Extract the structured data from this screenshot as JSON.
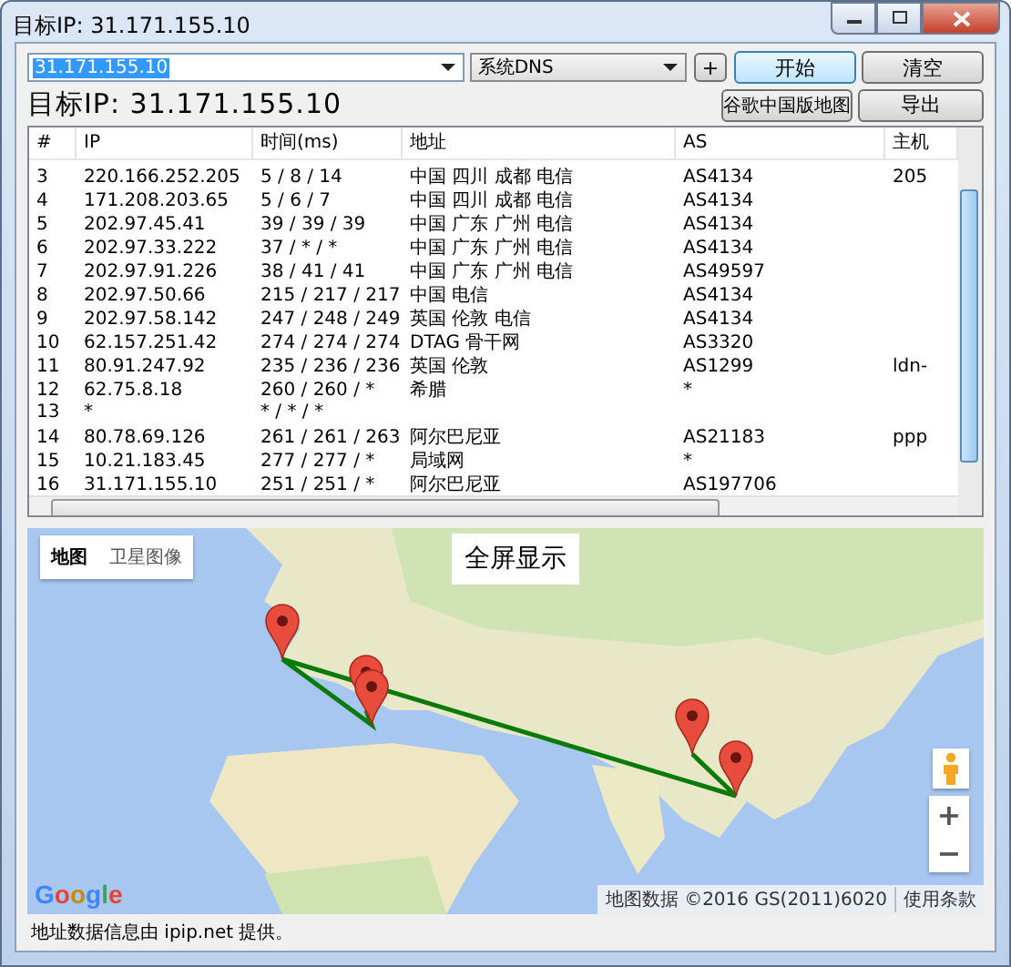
{
  "window": {
    "title": "目标IP: 31.171.155.10"
  },
  "toolbar": {
    "target": {
      "value": "31.171.155.10"
    },
    "dns": {
      "value": "系统DNS"
    },
    "add_button": "+",
    "start_button": "开始",
    "clear_button": "清空",
    "map_button": "谷歌中国版地图",
    "export_button": "导出"
  },
  "target_label": "目标IP: 31.171.155.10",
  "table": {
    "columns": [
      "#",
      "IP",
      "时间(ms)",
      "地址",
      "AS",
      "主机"
    ],
    "rows": [
      [
        "3",
        "220.166.252.205",
        "5 / 8 / 14",
        "中国 四川 成都 电信",
        "AS4134",
        "205"
      ],
      [
        "4",
        "171.208.203.65",
        "5 / 6 / 7",
        "中国 四川 成都 电信",
        "AS4134",
        ""
      ],
      [
        "5",
        "202.97.45.41",
        "39 / 39 / 39",
        "中国 广东 广州 电信",
        "AS4134",
        ""
      ],
      [
        "6",
        "202.97.33.222",
        "37 / * / *",
        "中国 广东 广州 电信",
        "AS4134",
        ""
      ],
      [
        "7",
        "202.97.91.226",
        "38 / 41 / 41",
        "中国 广东 广州 电信",
        "AS49597",
        ""
      ],
      [
        "8",
        "202.97.50.66",
        "215 / 217 / 217",
        "中国 电信",
        "AS4134",
        ""
      ],
      [
        "9",
        "202.97.58.142",
        "247 / 248 / 249",
        "英国 伦敦 电信",
        "AS4134",
        ""
      ],
      [
        "10",
        "62.157.251.42",
        "274 / 274 / 274",
        "DTAG 骨干网",
        "AS3320",
        ""
      ],
      [
        "11",
        "80.91.247.92",
        "235 / 236 / 236",
        "英国 伦敦",
        "AS1299",
        "ldn-"
      ],
      [
        "12",
        "62.75.8.18",
        "260 / 260 / *",
        "希腊",
        "*",
        ""
      ],
      [
        "13",
        "*",
        "* / * / *",
        "",
        "",
        ""
      ],
      [
        "14",
        "80.78.69.126",
        "261 / 261 / 263",
        "阿尔巴尼亚",
        "AS21183",
        "ppp"
      ],
      [
        "15",
        "10.21.183.45",
        "277 / 277 / *",
        "局域网",
        "*",
        ""
      ],
      [
        "16",
        "31.171.155.10",
        "251 / 251 / *",
        "阿尔巴尼亚",
        "AS197706",
        ""
      ]
    ]
  },
  "map": {
    "kind": "picture",
    "map_types": [
      {
        "label": "地图",
        "selected": true
      },
      {
        "label": "卫星图像",
        "selected": false
      }
    ],
    "fullscreen_button": "全屏显示",
    "zoom_in": "+",
    "zoom_out": "−",
    "logo": "Google",
    "attribution": "地图数据 ©2016 GS(2011)6020",
    "terms": "使用条款"
  },
  "footer": "地址数据信息由 ipip.net 提供。"
}
